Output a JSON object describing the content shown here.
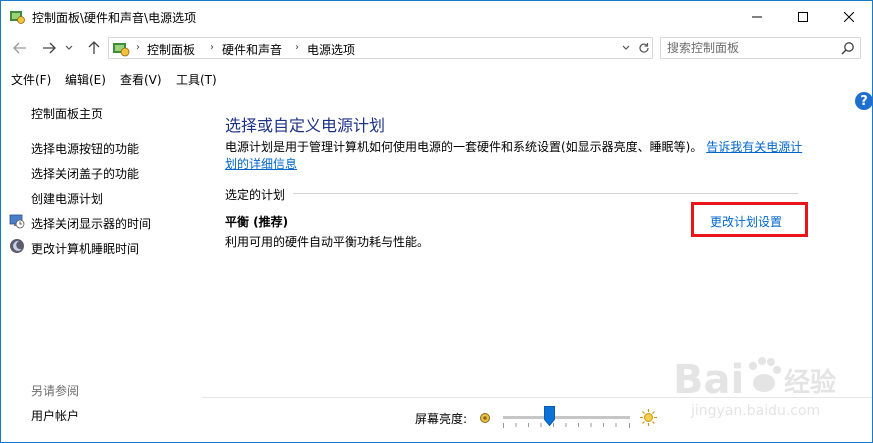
{
  "window": {
    "title": "控制面板\\硬件和声音\\电源选项",
    "buttons": {
      "minimize": "—",
      "maximize": "☐",
      "close": "✕"
    }
  },
  "address": {
    "crumbs": [
      "控制面板",
      "硬件和声音",
      "电源选项"
    ],
    "search_placeholder": "搜索控制面板"
  },
  "menu": {
    "items": [
      "文件(F)",
      "编辑(E)",
      "查看(V)",
      "工具(T)"
    ]
  },
  "sidebar": {
    "home": "控制面板主页",
    "links": [
      "选择电源按钮的功能",
      "选择关闭盖子的功能",
      "创建电源计划",
      "选择关闭显示器的时间",
      "更改计算机睡眠时间"
    ],
    "see_also_title": "另请参阅",
    "see_also_links": [
      "用户帐户"
    ]
  },
  "main": {
    "help": "?",
    "title": "选择或自定义电源计划",
    "description": "电源计划是用于管理计算机如何使用电源的一套硬件和系统设置(如显示器亮度、睡眠等)。",
    "description_link": "告诉我有关电源计划的详细信息",
    "section_label": "选定的计划",
    "plan": {
      "name": "平衡 (推荐)",
      "description": "利用可用的硬件自动平衡功耗与性能。",
      "change_link": "更改计划设置"
    }
  },
  "brightness": {
    "label": "屏幕亮度:",
    "level": 0.37
  },
  "watermark": {
    "brand": "Bai",
    "brand_cn": "经验",
    "url": "jingyan.baidu.com"
  },
  "colors": {
    "accent": "#1979ca",
    "title_text": "#1e3287",
    "link": "#0066cc",
    "highlight": "#e8141a"
  }
}
